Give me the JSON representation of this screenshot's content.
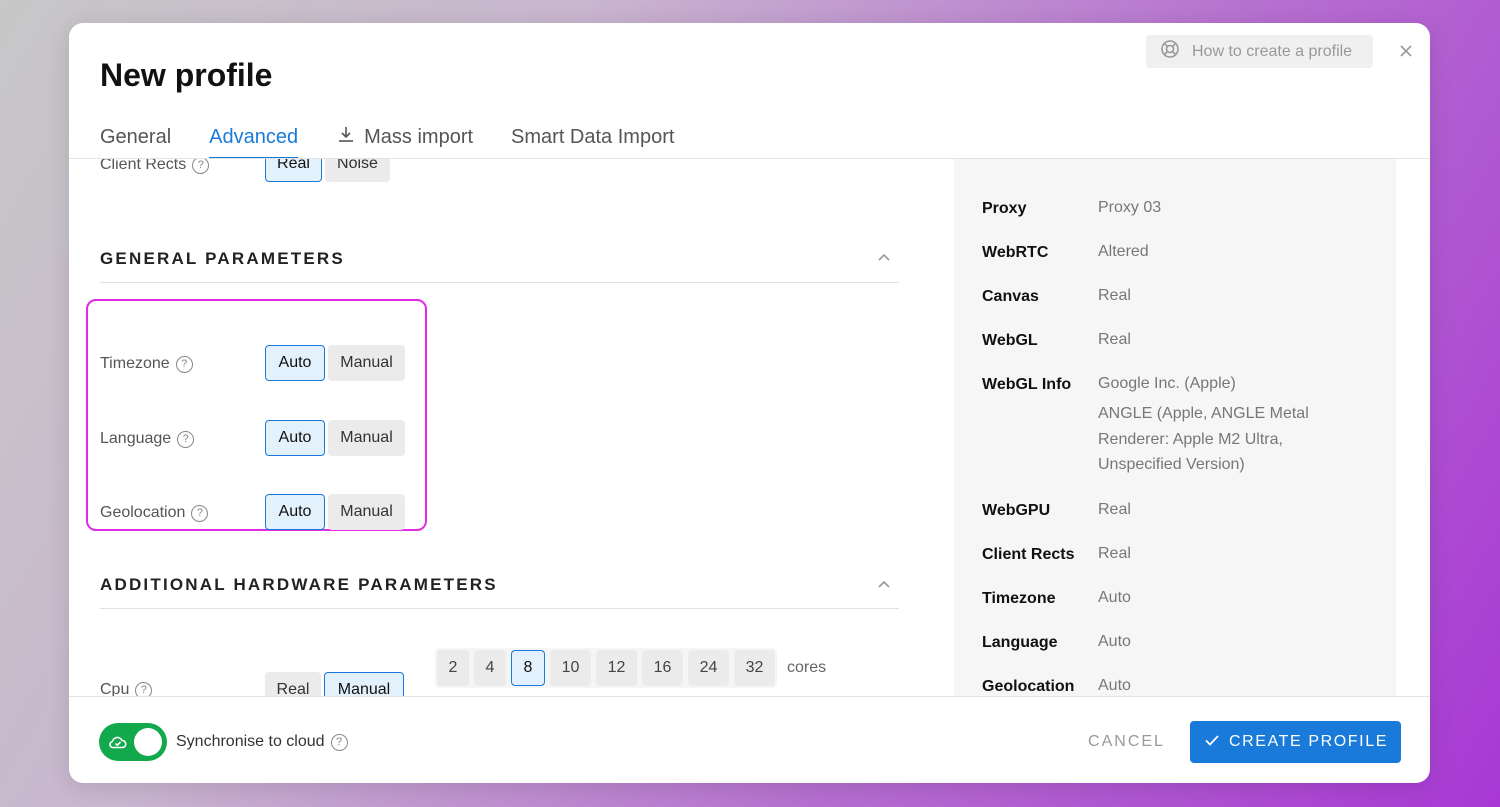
{
  "modal": {
    "title": "New profile",
    "help_label": "How to create a profile"
  },
  "tabs": [
    {
      "label": "General"
    },
    {
      "label": "Advanced"
    },
    {
      "label": "Mass import"
    },
    {
      "label": "Smart Data Import"
    }
  ],
  "client_rects": {
    "label": "Client Rects",
    "options": [
      "Real",
      "Noise"
    ],
    "selected": "Real"
  },
  "general_parameters": {
    "title": "GENERAL PARAMETERS",
    "rows": [
      {
        "label": "Timezone",
        "options": [
          "Auto",
          "Manual"
        ],
        "selected": "Auto"
      },
      {
        "label": "Language",
        "options": [
          "Auto",
          "Manual"
        ],
        "selected": "Auto"
      },
      {
        "label": "Geolocation",
        "options": [
          "Auto",
          "Manual"
        ],
        "selected": "Auto"
      }
    ]
  },
  "hardware_parameters": {
    "title": "ADDITIONAL HARDWARE PARAMETERS",
    "cpu": {
      "label": "Cpu",
      "modes": [
        "Real",
        "Manual"
      ],
      "selected_mode": "Manual",
      "cores": [
        "2",
        "4",
        "8",
        "10",
        "12",
        "16",
        "24",
        "32"
      ],
      "selected_core": "8",
      "unit": "cores"
    }
  },
  "summary": [
    {
      "key": "Proxy",
      "value": "Proxy 03"
    },
    {
      "key": "WebRTC",
      "value": "Altered"
    },
    {
      "key": "Canvas",
      "value": "Real"
    },
    {
      "key": "WebGL",
      "value": "Real"
    },
    {
      "key": "WebGL Info",
      "value": "Google Inc. (Apple)",
      "value2": "ANGLE (Apple, ANGLE Metal Renderer: Apple M2 Ultra, Unspecified Version)"
    },
    {
      "key": "WebGPU",
      "value": "Real"
    },
    {
      "key": "Client Rects",
      "value": "Real"
    },
    {
      "key": "Timezone",
      "value": "Auto"
    },
    {
      "key": "Language",
      "value": "Auto"
    },
    {
      "key": "Geolocation",
      "value": "Auto"
    }
  ],
  "footer": {
    "sync_label": "Synchronise to cloud",
    "sync_enabled": true,
    "cancel_label": "CANCEL",
    "create_label": "CREATE PROFILE"
  },
  "colors": {
    "accent": "#1a7ad9",
    "toggle_on": "#12a84c",
    "highlight": "#e32ae8"
  }
}
